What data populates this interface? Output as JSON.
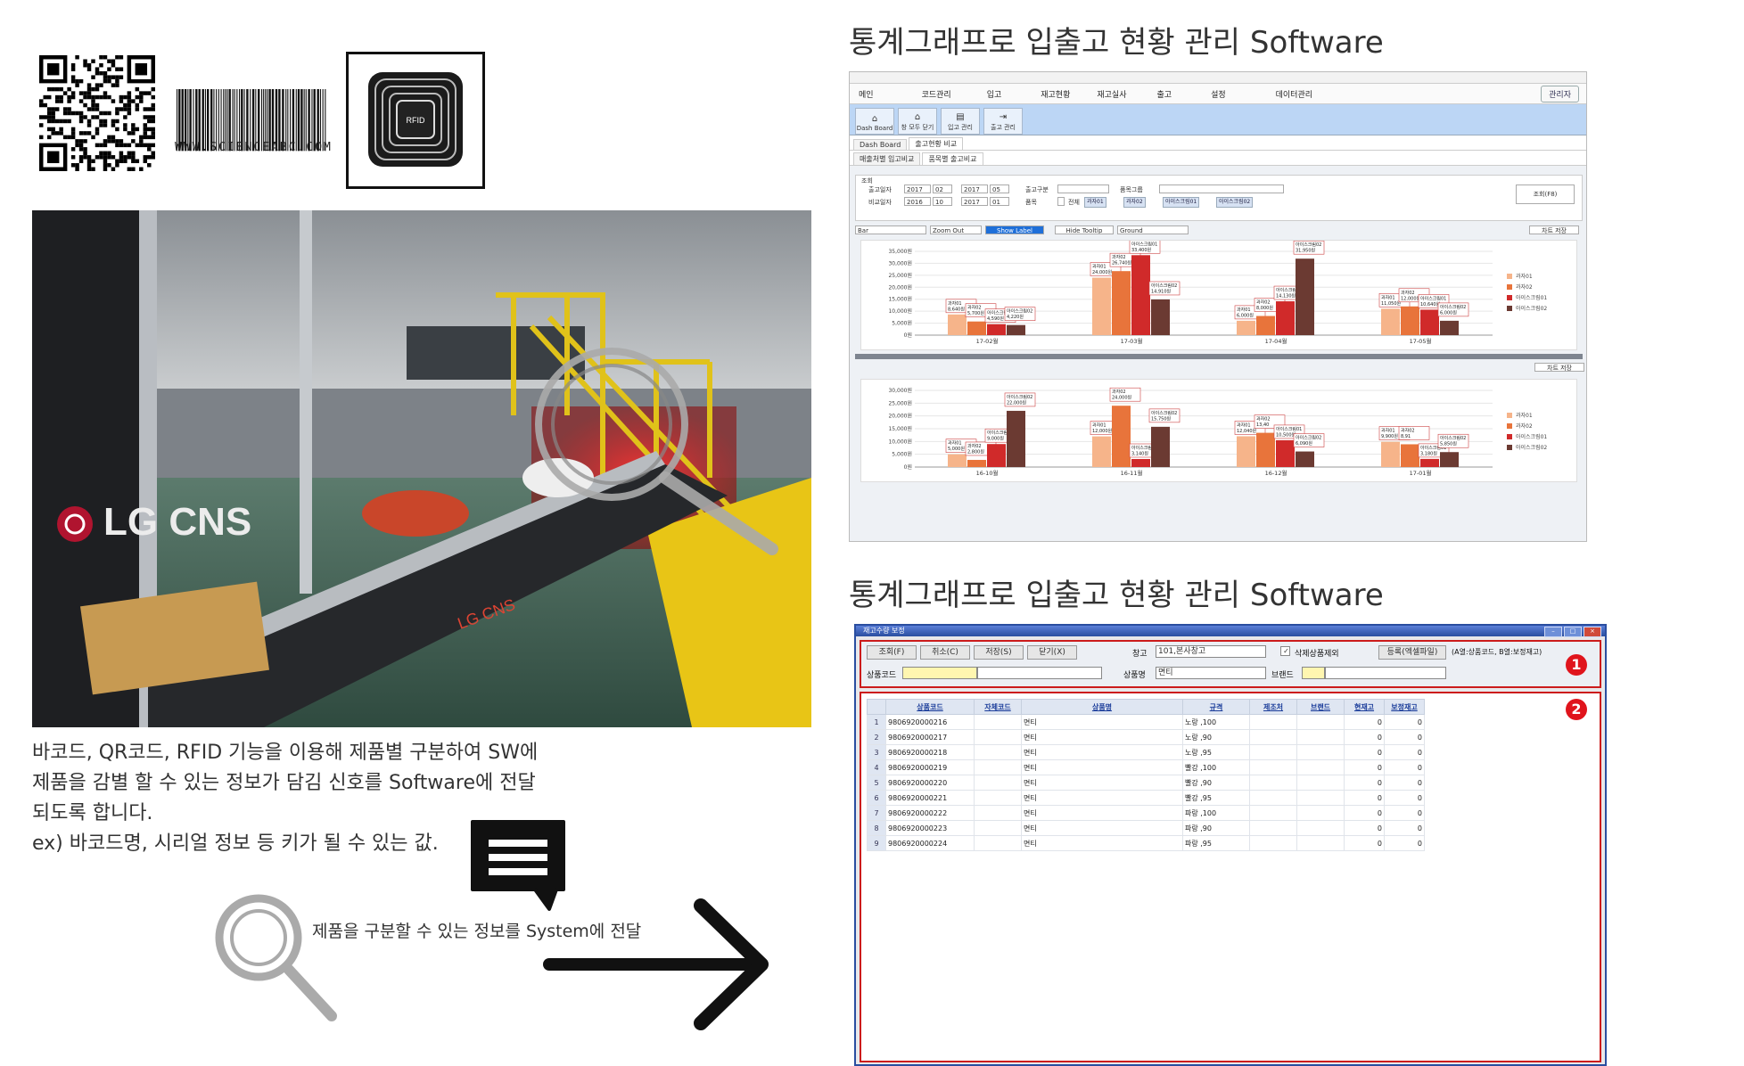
{
  "barcode_caption": "WWW.SCIENCEABC.COM",
  "rfid_label": "RFID",
  "photo": {
    "brand_text": "LG CNS",
    "belt_brand": "LG CNS"
  },
  "description": {
    "lines": [
      "바코드, QR코드, RFID 기능을 이용해 제품별 구분하여 SW에",
      "제품을 감별 할 수 있는 정보가 담김 신호를 Software에 전달",
      "되도록 합니다.",
      "ex) 바코드명, 시리얼 정보 등 키가 될 수 있는 값."
    ]
  },
  "arrow_caption": "제품을 구분할 수 있는 정보를 System에 전달",
  "heading_top": "통계그래프로 입출고 현황 관리 Software",
  "heading_bottom": "통계그래프로 입출고 현황 관리 Software",
  "window1": {
    "menu": [
      "메인",
      "코드관리",
      "입고",
      "재고현황",
      "재고실사",
      "출고",
      "설정",
      "데이터관리"
    ],
    "admin": "관리자",
    "toolbar": [
      "Dash Board",
      "창 모두 닫기",
      "입고 관리",
      "출고 관리"
    ],
    "tabs": [
      "Dash Board",
      "출고현황 비교"
    ],
    "subtabs": [
      "매출처별 입고비교",
      "품목별 출고비교"
    ],
    "filter": {
      "section": "조회",
      "ship_date_label": "출고일자",
      "compare_date_label": "비교일자",
      "ship_from": [
        "2017",
        "02"
      ],
      "ship_to": [
        "2017",
        "05"
      ],
      "cmp_from": [
        "2016",
        "10"
      ],
      "cmp_to": [
        "2017",
        "01"
      ],
      "type_label": "출고구분",
      "group_label": "품목그룹",
      "item_label": "품목",
      "all_label": "전체",
      "chips": [
        "과자01",
        "과자02",
        "아이스크림01",
        "아이스크림02"
      ],
      "search_button": "조회(F8)"
    },
    "chart_controls": {
      "type": "Bar",
      "zoom_out": "Zoom Out",
      "show_label": "Show Label",
      "hide_tooltip": "Hide Tooltip",
      "theme": "Ground",
      "save": "차트 저장"
    },
    "legend": [
      "과자01",
      "과자02",
      "아이스크림01",
      "아이스크림02"
    ],
    "series_colors": [
      "#f6b48a",
      "#e8743b",
      "#d02a2a",
      "#6b3a32"
    ]
  },
  "chart_data": [
    {
      "type": "bar",
      "categories": [
        "17-02월",
        "17-03월",
        "17-04월",
        "17-05월"
      ],
      "series": [
        {
          "name": "과자01",
          "values": [
            8640,
            24000,
            6000,
            11050
          ]
        },
        {
          "name": "과자02",
          "values": [
            5700,
            26740,
            8000,
            12000
          ]
        },
        {
          "name": "아이스크림01",
          "values": [
            4590,
            33400,
            14130,
            10640
          ]
        },
        {
          "name": "아이스크림02",
          "values": [
            4220,
            14910,
            31950,
            6000
          ]
        }
      ],
      "data_labels": [
        [
          "과자01\n8,640원",
          "과자02\n5,700원",
          "아이스크림01\n4,590원",
          "아이스크림02\n4,220원"
        ],
        [
          "과자01\n24,000원",
          "과자02\n26,740원",
          "아이스크림01\n33,400원",
          "아이스크림02\n14,910원"
        ],
        [
          "과자01\n6,000원",
          "과자02\n8,000원",
          "아이스크림01\n14,130원",
          "아이스크림02\n31,950원"
        ],
        [
          "과자01\n11,050원",
          "과자02\n12,000원",
          "아이스크림01\n10,640원",
          "아이스크림02\n6,000원"
        ]
      ],
      "yticks": [
        "35,000원",
        "30,000원",
        "25,000원",
        "20,000원",
        "15,000원",
        "10,000원",
        "5,000원",
        "0원"
      ],
      "ylim": [
        0,
        35000
      ]
    },
    {
      "type": "bar",
      "categories": [
        "16-10월",
        "16-11월",
        "16-12월",
        "17-01월"
      ],
      "series": [
        {
          "name": "과자01",
          "values": [
            5000,
            12000,
            12040,
            9900
          ]
        },
        {
          "name": "과자02",
          "values": [
            2800,
            24000,
            13400,
            8910
          ]
        },
        {
          "name": "아이스크림01",
          "values": [
            9000,
            3140,
            10500,
            3180
          ]
        },
        {
          "name": "아이스크림02",
          "values": [
            22000,
            15750,
            6090,
            5850
          ]
        }
      ],
      "data_labels": [
        [
          "과자01\n5,000원",
          "과자02\n2,800원",
          "아이스크림01\n9,000원",
          "아이스크림02\n22,000원"
        ],
        [
          "과자01\n12,000원",
          "과자02\n24,000원",
          "아이스크림01\n3,140원",
          "아이스크림02\n15,750원"
        ],
        [
          "과자01\n12,040원",
          "과자02\n13,40",
          "아이스크림01\n10,500원",
          "아이스크림02\n6,090원"
        ],
        [
          "과자01\n9,900원",
          "과자02\n8,91",
          "아이스크림01\n3,180원",
          "아이스크림02\n5,850원"
        ]
      ],
      "yticks": [
        "30,000원",
        "25,000원",
        "20,000원",
        "15,000원",
        "10,000원",
        "5,000원",
        "0원"
      ],
      "ylim": [
        0,
        30000
      ]
    }
  ],
  "window2": {
    "title": "재고수량 보정",
    "buttons": [
      "조회(F)",
      "취소(C)",
      "저장(S)",
      "닫기(X)"
    ],
    "warehouse_label": "창고",
    "warehouse_value": "101,본사창고",
    "exclude_deleted": "삭제상품제외",
    "register_button": "등록(엑셀파일)",
    "register_note": "(A열:상품코드, B열:보정재고)",
    "product_code_label": "상품코드",
    "product_name_label": "상품명",
    "product_name_value": "면티",
    "brand_label": "브랜드",
    "badges": [
      "1",
      "2"
    ],
    "columns": [
      "상품코드",
      "자체코드",
      "상품명",
      "규격",
      "제조처",
      "브랜드",
      "현재고",
      "보정재고"
    ],
    "rows": [
      [
        "1",
        "9806920000216",
        "",
        "면티",
        "노랑 ,100",
        "",
        "",
        "0",
        "0"
      ],
      [
        "2",
        "9806920000217",
        "",
        "면티",
        "노랑 ,90",
        "",
        "",
        "0",
        "0"
      ],
      [
        "3",
        "9806920000218",
        "",
        "면티",
        "노랑 ,95",
        "",
        "",
        "0",
        "0"
      ],
      [
        "4",
        "9806920000219",
        "",
        "면티",
        "빨강 ,100",
        "",
        "",
        "0",
        "0"
      ],
      [
        "5",
        "9806920000220",
        "",
        "면티",
        "빨강 ,90",
        "",
        "",
        "0",
        "0"
      ],
      [
        "6",
        "9806920000221",
        "",
        "면티",
        "빨강 ,95",
        "",
        "",
        "0",
        "0"
      ],
      [
        "7",
        "9806920000222",
        "",
        "면티",
        "파랑 ,100",
        "",
        "",
        "0",
        "0"
      ],
      [
        "8",
        "9806920000223",
        "",
        "면티",
        "파랑 ,90",
        "",
        "",
        "0",
        "0"
      ],
      [
        "9",
        "9806920000224",
        "",
        "면티",
        "파랑 ,95",
        "",
        "",
        "0",
        "0"
      ]
    ]
  }
}
